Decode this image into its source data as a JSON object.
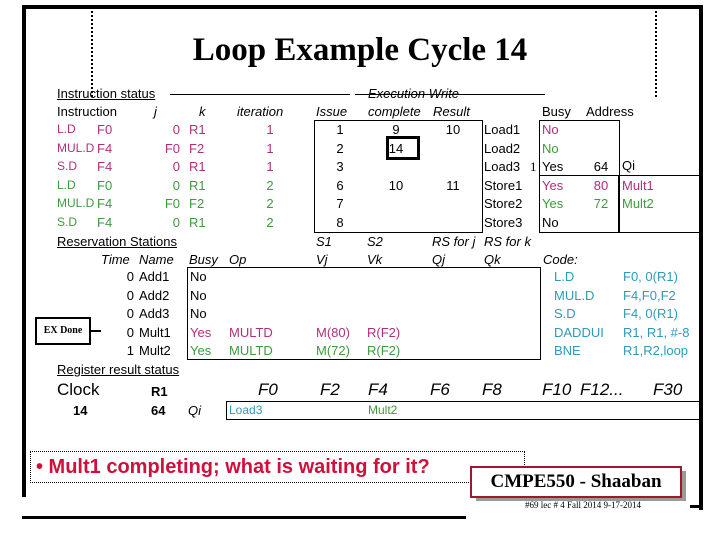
{
  "title": "Loop Example Cycle 14",
  "instruction_status": {
    "section_label": "Instruction status",
    "headers": {
      "instruction": "Instruction",
      "j": "j",
      "k": "k",
      "iteration": "iteration",
      "exec_write_top": "Execution Write",
      "issue": "Issue",
      "complete": "complete",
      "result": "Result"
    },
    "rows": [
      {
        "op": "L.D",
        "dest": "F0",
        "j": "0",
        "k": "R1",
        "iteration": "1",
        "issue": "1",
        "complete": "9",
        "result": "10",
        "color": "#b0307a"
      },
      {
        "op": "MUL.D",
        "dest": "F4",
        "j": "F0",
        "k": "F2",
        "iteration": "1",
        "issue": "2",
        "complete": "14",
        "result": "",
        "color": "#b0307a"
      },
      {
        "op": "S.D",
        "dest": "F4",
        "j": "0",
        "k": "R1",
        "iteration": "1",
        "issue": "3",
        "complete": "",
        "result": "",
        "color": "#b0307a"
      },
      {
        "op": "L.D",
        "dest": "F0",
        "j": "0",
        "k": "R1",
        "iteration": "2",
        "issue": "6",
        "complete": "10",
        "result": "11",
        "color": "#3e9a3e"
      },
      {
        "op": "MUL.D",
        "dest": "F4",
        "j": "F0",
        "k": "F2",
        "iteration": "2",
        "issue": "7",
        "complete": "",
        "result": "",
        "color": "#3e9a3e"
      },
      {
        "op": "S.D",
        "dest": "F4",
        "j": "0",
        "k": "R1",
        "iteration": "2",
        "issue": "8",
        "complete": "",
        "result": "",
        "color": "#3e9a3e"
      }
    ]
  },
  "load_store_buffers": {
    "headers": {
      "busy": "Busy",
      "address": "Address",
      "qi": "Qi"
    },
    "rows": [
      {
        "name": "Load1",
        "count": "",
        "busy": "No",
        "address": "",
        "qi": "",
        "color": "#b0307a"
      },
      {
        "name": "Load2",
        "count": "",
        "busy": "No",
        "address": "",
        "qi": "",
        "color": "#3e9a3e"
      },
      {
        "name": "Load3",
        "count": "1",
        "busy": "Yes",
        "address": "64",
        "qi": "",
        "color": "#000000"
      },
      {
        "name": "Store1",
        "count": "",
        "busy": "Yes",
        "address": "80",
        "qi": "Mult1",
        "color": "#b0307a"
      },
      {
        "name": "Store2",
        "count": "",
        "busy": "Yes",
        "address": "72",
        "qi": "Mult2",
        "color": "#3e9a3e"
      },
      {
        "name": "Store3",
        "count": "",
        "busy": "No",
        "address": "",
        "qi": "",
        "color": "#000000"
      }
    ]
  },
  "reservation_stations": {
    "section_label": "Reservation Stations",
    "headers": {
      "time": "Time",
      "name": "Name",
      "busy": "Busy",
      "op": "Op",
      "s1": "S1",
      "s2": "S2",
      "rsj": "RS for j",
      "rsk": "RS for k",
      "vj": "Vj",
      "vk": "Vk",
      "qj": "Qj",
      "qk": "Qk"
    },
    "rows": [
      {
        "time": "0",
        "name": "Add1",
        "busy": "No",
        "op": "",
        "vj": "",
        "vk": "",
        "qj": "",
        "qk": "",
        "color": "#000000"
      },
      {
        "time": "0",
        "name": "Add2",
        "busy": "No",
        "op": "",
        "vj": "",
        "vk": "",
        "qj": "",
        "qk": "",
        "color": "#000000"
      },
      {
        "time": "0",
        "name": "Add3",
        "busy": "No",
        "op": "",
        "vj": "",
        "vk": "",
        "qj": "",
        "qk": "",
        "color": "#000000"
      },
      {
        "time": "0",
        "name": "Mult1",
        "busy": "Yes",
        "op": "MULTD",
        "vj": "M(80)",
        "vk": "R(F2)",
        "qj": "",
        "qk": "",
        "color": "#b0307a"
      },
      {
        "time": "1",
        "name": "Mult2",
        "busy": "Yes",
        "op": "MULTD",
        "vj": "M(72)",
        "vk": "R(F2)",
        "qj": "",
        "qk": "",
        "color": "#3e9a3e"
      }
    ],
    "callout": "EX Done"
  },
  "code": {
    "label": "Code:",
    "lines": [
      {
        "op": "L.D",
        "args": "F0, 0(R1)"
      },
      {
        "op": "MUL.D",
        "args": "F4,F0,F2"
      },
      {
        "op": "S.D",
        "args": "F4, 0(R1)"
      },
      {
        "op": "DADDUI",
        "args": "R1, R1, #-8"
      },
      {
        "op": "BNE",
        "args": "R1,R2,loop"
      }
    ]
  },
  "register_status": {
    "section_label": "Register result status",
    "clock_label": "Clock",
    "clock_value": "14",
    "r1_label": "R1",
    "r1_value": "64",
    "qi_label": "Qi",
    "registers": [
      "F0",
      "F2",
      "F4",
      "F6",
      "F8",
      "F10",
      "F12...",
      "F30"
    ],
    "qi_values": [
      "Load3",
      "",
      "Mult2",
      "",
      "",
      "",
      "",
      ""
    ]
  },
  "bullet": "• Mult1 completing; what is waiting for it?",
  "footer": {
    "course": "CMPE550 - Shaaban",
    "info": "#69   lec # 4 Fall 2014    9-17-2014"
  }
}
